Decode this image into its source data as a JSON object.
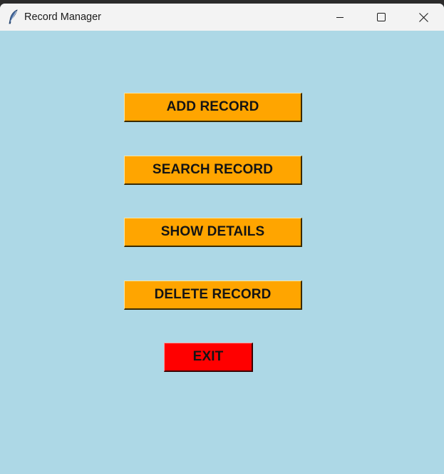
{
  "window": {
    "title": "Record Manager",
    "app_icon": "feather-icon",
    "controls": {
      "minimize_icon": "minimize-icon",
      "maximize_icon": "maximize-icon",
      "close_icon": "close-icon"
    }
  },
  "colors": {
    "background": "#add8e6",
    "titlebar": "#f3f3f3",
    "primary_button": "#ffa500",
    "exit_button": "#ff0000"
  },
  "buttons": {
    "add": "ADD RECORD",
    "search": "SEARCH RECORD",
    "show": "SHOW DETAILS",
    "delete": "DELETE RECORD",
    "exit": "EXIT"
  }
}
